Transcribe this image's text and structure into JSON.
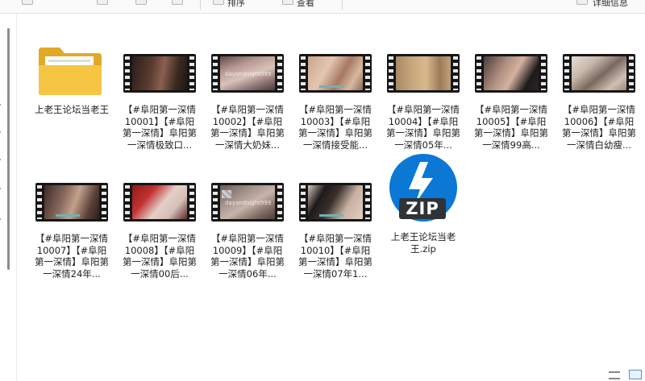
{
  "toolbar": {
    "sort_label": "排序",
    "view_label": "查看",
    "details_label": "详细信息"
  },
  "items": [
    {
      "name": "上老王论坛当老王",
      "type": "folder"
    },
    {
      "name": "【#阜阳第一深情10001】【#阜阳第一深情】阜阳第一深情极致口...",
      "type": "video",
      "watermark": ""
    },
    {
      "name": "【#阜阳第一深情10002】【#阜阳第一深情】阜阳第一深情大奶妹...",
      "type": "video",
      "watermark": "dayandnight999"
    },
    {
      "name": "【#阜阳第一深情10003】【#阜阳第一深情】阜阳第一深情接受能...",
      "type": "video",
      "watermark": ""
    },
    {
      "name": "【#阜阳第一深情10004】【#阜阳第一深情】阜阳第一深情05年...",
      "type": "video",
      "watermark": ""
    },
    {
      "name": "【#阜阳第一深情10005】【#阜阳第一深情】阜阳第一深情99高...",
      "type": "video",
      "watermark": ""
    },
    {
      "name": "【#阜阳第一深情10006】【#阜阳第一深情】阜阳第一深情白幼瘦...",
      "type": "video",
      "watermark": ""
    },
    {
      "name": "【#阜阳第一深情10007】【#阜阳第一深情】阜阳第一深情24年...",
      "type": "video",
      "watermark": ""
    },
    {
      "name": "【#阜阳第一深情10008】【#阜阳第一深情】阜阳第一深情00后...",
      "type": "video",
      "watermark": ""
    },
    {
      "name": "【#阜阳第一深情10009】【#阜阳第一深情】阜阳第一深情06年...",
      "type": "video",
      "watermark": "dayandnight999"
    },
    {
      "name": "【#阜阳第一深情10010】【#阜阳第一深情】阜阳第一深情07年1...",
      "type": "video",
      "watermark": ""
    },
    {
      "name": "上老王论坛当老王.zip",
      "type": "zip",
      "badge": "ZIP"
    }
  ],
  "colors": {
    "folder": "#f6c544",
    "zip_blue": "#0b78d6",
    "zip_badge": "#2f3236",
    "filmstrip": "#161616"
  }
}
